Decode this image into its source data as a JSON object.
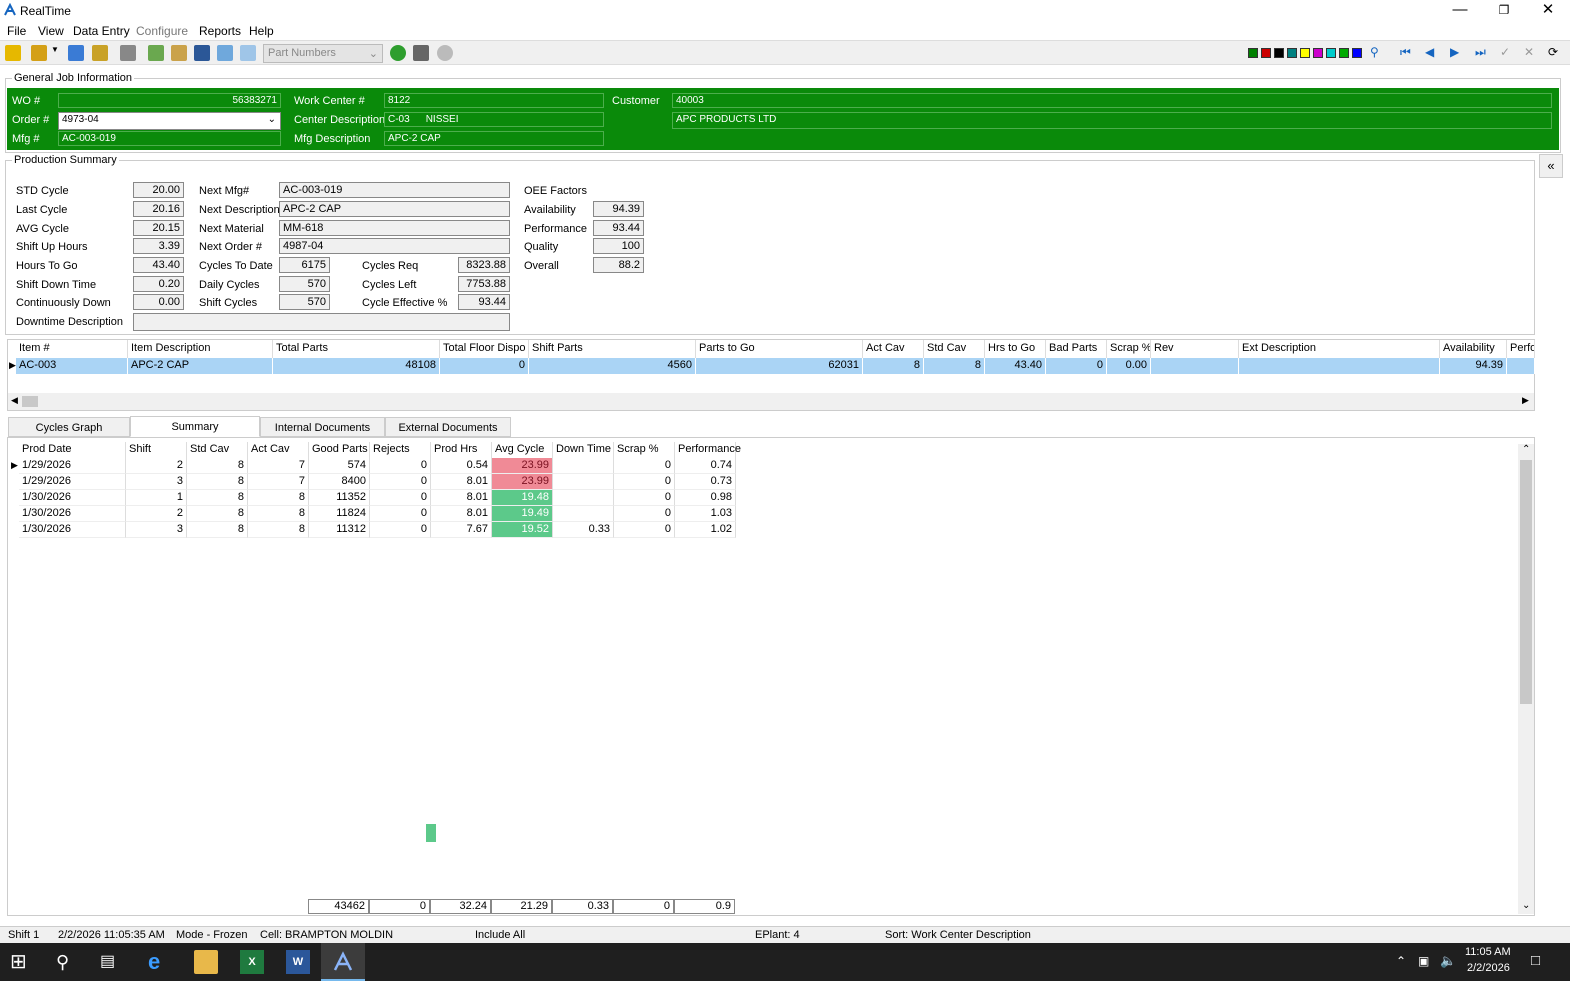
{
  "window": {
    "title": "RealTime"
  },
  "menu": [
    "File",
    "View",
    "Data Entry",
    "Configure",
    "Reports",
    "Help"
  ],
  "toolbar": {
    "combo_value": "Part Numbers",
    "swatch_colors": [
      "#008000",
      "#cc0000",
      "#000000",
      "#008080",
      "#ffff00",
      "#cc00cc",
      "#00cccc",
      "#00aa00",
      "#0000ff"
    ]
  },
  "general": {
    "group_label": "General Job Information",
    "wo_label": "WO #",
    "wo_value": "56383271",
    "order_label": "Order #",
    "order_value": "4973-04",
    "mfg_label": "Mfg #",
    "mfg_value": "AC-003-019",
    "wc_label": "Work Center #",
    "wc_value": "8122",
    "cd_label": "Center Description",
    "cd_code": "C-03",
    "cd_value": "NISSEI",
    "md_label": "Mfg Description",
    "md_value": "APC-2 CAP",
    "cust_label": "Customer",
    "cust_code": "40003",
    "cust_name": "APC PRODUCTS LTD"
  },
  "prod": {
    "group_label": "Production Summary",
    "std_cycle_l": "STD Cycle",
    "std_cycle": "20.00",
    "last_cycle_l": "Last Cycle",
    "last_cycle": "20.16",
    "avg_cycle_l": "AVG Cycle",
    "avg_cycle": "20.15",
    "shift_up_l": "Shift Up Hours",
    "shift_up": "3.39",
    "hours_to_go_l": "Hours To Go",
    "hours_to_go": "43.40",
    "shift_down_l": "Shift Down Time",
    "shift_down": "0.20",
    "cont_down_l": "Continuously Down",
    "cont_down": "0.00",
    "downtime_desc_l": "Downtime Description",
    "downtime_desc": "",
    "next_mfg_l": "Next Mfg#",
    "next_mfg": "AC-003-019",
    "next_desc_l": "Next Description",
    "next_desc": "APC-2 CAP",
    "next_mat_l": "Next Material",
    "next_mat": "MM-618",
    "next_order_l": "Next Order #",
    "next_order": "4987-04",
    "cycles_to_date_l": "Cycles To Date",
    "cycles_to_date": "6175",
    "daily_cycles_l": "Daily Cycles",
    "daily_cycles": "570",
    "shift_cycles_l": "Shift Cycles",
    "shift_cycles": "570",
    "cycles_req_l": "Cycles Req",
    "cycles_req": "8323.88",
    "cycles_left_l": "Cycles Left",
    "cycles_left": "7753.88",
    "cycle_eff_l": "Cycle Effective %",
    "cycle_eff": "93.44",
    "oee_l": "OEE Factors",
    "avail_l": "Availability",
    "avail": "94.39",
    "perf_l": "Performance",
    "perf": "93.44",
    "quality_l": "Quality",
    "quality": "100",
    "overall_l": "Overall",
    "overall": "88.2"
  },
  "items": {
    "headers": [
      "Item #",
      "Item Description",
      "Total Parts",
      "Total Floor Dispo",
      "Shift Parts",
      "Parts to Go",
      "Act Cav",
      "Std Cav",
      "Hrs to Go",
      "Bad Parts",
      "Scrap %",
      "Rev",
      "Ext Description",
      "Availability",
      "Perfo"
    ],
    "row": [
      "AC-003",
      "APC-2 CAP",
      "48108",
      "0",
      "4560",
      "62031",
      "8",
      "8",
      "43.40",
      "0",
      "0.00",
      "",
      "",
      "94.39",
      ""
    ]
  },
  "tabs": [
    "Cycles Graph",
    "Summary",
    "Internal Documents",
    "External Documents"
  ],
  "summary": {
    "headers": [
      "Prod Date",
      "Shift",
      "Std Cav",
      "Act Cav",
      "Good Parts",
      "Rejects",
      "Prod Hrs",
      "Avg Cycle",
      "Down Time",
      "Scrap %",
      "Performance"
    ],
    "rows": [
      [
        "1/29/2026",
        "2",
        "8",
        "7",
        "574",
        "0",
        "0.54",
        "23.99",
        "",
        "0",
        "0.74"
      ],
      [
        "1/29/2026",
        "3",
        "8",
        "7",
        "8400",
        "0",
        "8.01",
        "23.99",
        "",
        "0",
        "0.73"
      ],
      [
        "1/30/2026",
        "1",
        "8",
        "8",
        "11352",
        "0",
        "8.01",
        "19.48",
        "",
        "0",
        "0.98"
      ],
      [
        "1/30/2026",
        "2",
        "8",
        "8",
        "11824",
        "0",
        "8.01",
        "19.49",
        "",
        "0",
        "1.03"
      ],
      [
        "1/30/2026",
        "3",
        "8",
        "8",
        "11312",
        "0",
        "7.67",
        "19.52",
        "0.33",
        "0",
        "1.02"
      ]
    ],
    "totals": [
      "43462",
      "0",
      "32.24",
      "21.29",
      "0.33",
      "0",
      "0.9"
    ]
  },
  "status": {
    "shift": "Shift 1",
    "datetime": "2/2/2026 11:05:35 AM",
    "mode": "Mode - Frozen",
    "cell": "Cell: BRAMPTON MOLDIN",
    "include": "Include All",
    "eplant": "EPlant: 4",
    "sort": "Sort: Work Center Description"
  },
  "taskbar": {
    "time": "11:05 AM",
    "date": "2/2/2026"
  }
}
